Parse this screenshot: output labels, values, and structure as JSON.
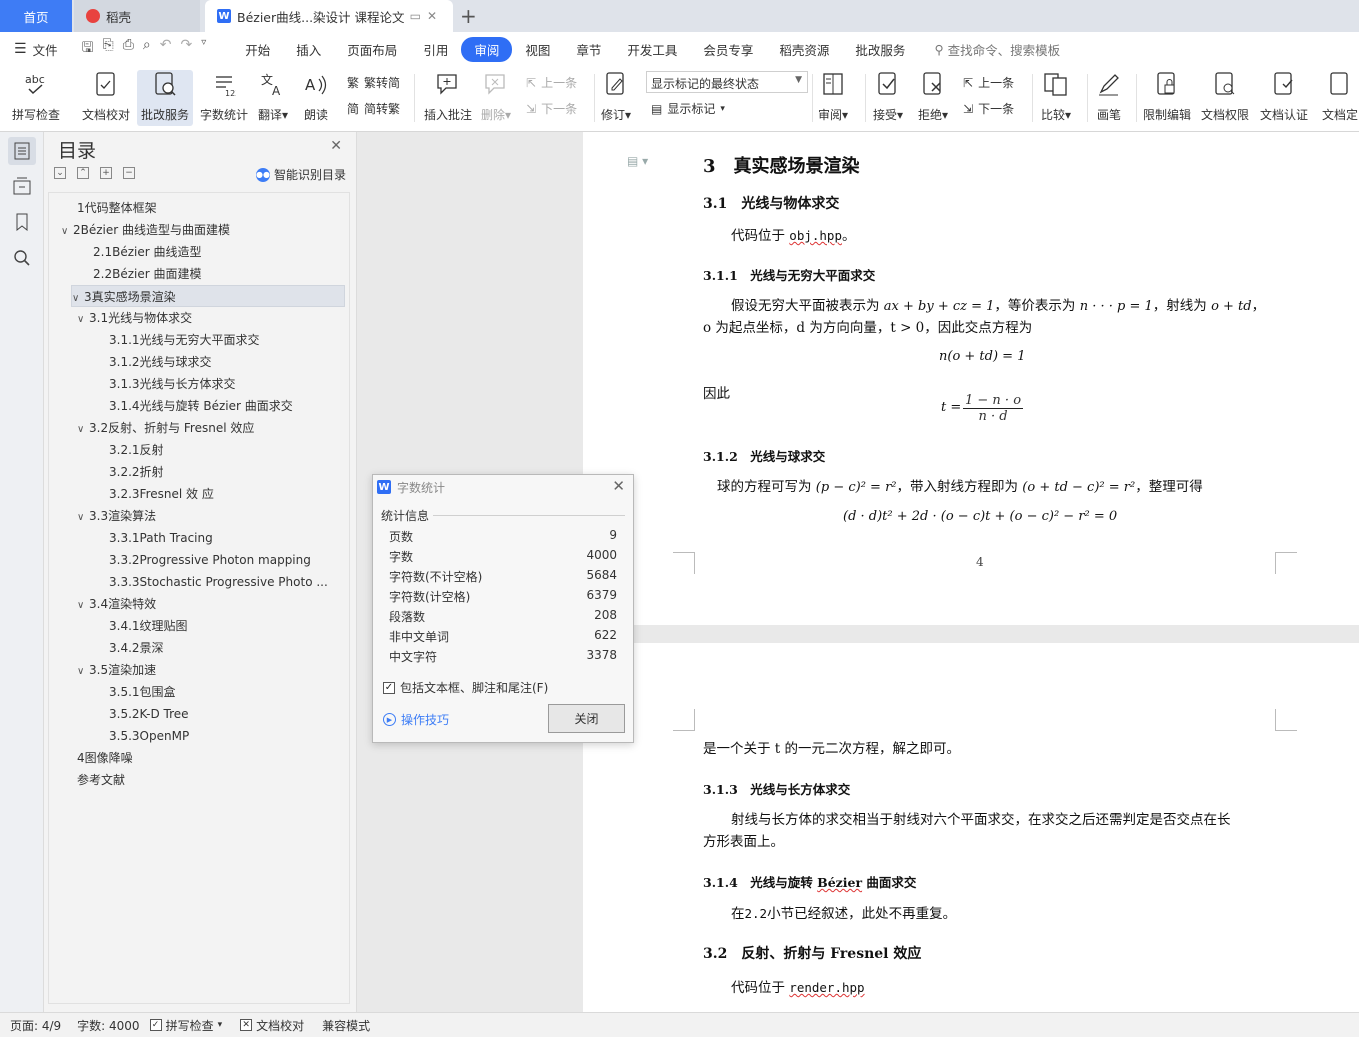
{
  "tabs": {
    "home": "首页",
    "daoke": "稻壳",
    "doc": "Bézier曲线...染设计 课程论文",
    "add": "+"
  },
  "menubar": {
    "file": "文件",
    "items": [
      "开始",
      "插入",
      "页面布局",
      "引用",
      "审阅",
      "视图",
      "章节",
      "开发工具",
      "会员专享",
      "稻壳资源",
      "批改服务"
    ],
    "active_item": "审阅",
    "search": "查找命令、搜索模板"
  },
  "ribbon": {
    "spellcheck": "拼写检查",
    "doc_check": "文档校对",
    "revise_service": "批改服务",
    "word_count": "字数统计",
    "translate": "翻译",
    "read": "朗读",
    "trad_to_simp": "繁转简",
    "simp_to_trad": "简转繁",
    "insert_comment": "插入批注",
    "delete": "删除",
    "prev_comment": "上一条",
    "next_comment": "下一条",
    "revise": "修订",
    "markup_state": "显示标记的最终状态",
    "show_markup": "显示标记",
    "review": "审阅",
    "accept": "接受",
    "reject": "拒绝",
    "prev_change": "上一条",
    "next_change": "下一条",
    "compare": "比较",
    "pen": "画笔",
    "restrict_edit": "限制编辑",
    "doc_rights": "文档权限",
    "doc_cert": "文档认证",
    "doc_fix": "文档定"
  },
  "toc": {
    "title": "目录",
    "smart": "智能识别目录",
    "items": [
      {
        "text": "1代码整体框架",
        "level": 1,
        "caret": ""
      },
      {
        "text": "2Bézier 曲线造型与曲面建模",
        "level": 1,
        "caret": "∨"
      },
      {
        "text": "2.1Bézier 曲线造型",
        "level": 2,
        "caret": ""
      },
      {
        "text": "2.2Bézier 曲面建模",
        "level": 2,
        "caret": ""
      },
      {
        "text": "3真实感场景渲染",
        "level": 1,
        "caret": "∨"
      },
      {
        "text": "3.1光线与物体求交",
        "level": 2,
        "caret": "∨"
      },
      {
        "text": "3.1.1光线与无穷大平面求交",
        "level": 3,
        "caret": ""
      },
      {
        "text": "3.1.2光线与球求交",
        "level": 3,
        "caret": ""
      },
      {
        "text": "3.1.3光线与长方体求交",
        "level": 3,
        "caret": ""
      },
      {
        "text": "3.1.4光线与旋转 Bézier 曲面求交",
        "level": 3,
        "caret": ""
      },
      {
        "text": "3.2反射、折射与 Fresnel 效应",
        "level": 2,
        "caret": "∨"
      },
      {
        "text": "3.2.1反射",
        "level": 3,
        "caret": ""
      },
      {
        "text": "3.2.2折射",
        "level": 3,
        "caret": ""
      },
      {
        "text": "3.2.3Fresnel 效 应",
        "level": 3,
        "caret": ""
      },
      {
        "text": "3.3渲染算法",
        "level": 2,
        "caret": "∨"
      },
      {
        "text": "3.3.1Path Tracing",
        "level": 3,
        "caret": ""
      },
      {
        "text": "3.3.2Progressive Photon mapping",
        "level": 3,
        "caret": ""
      },
      {
        "text": "3.3.3Stochastic Progressive Photo ...",
        "level": 3,
        "caret": ""
      },
      {
        "text": "3.4渲染特效",
        "level": 2,
        "caret": "∨"
      },
      {
        "text": "3.4.1纹理贴图",
        "level": 3,
        "caret": ""
      },
      {
        "text": "3.4.2景深",
        "level": 3,
        "caret": ""
      },
      {
        "text": "3.5渲染加速",
        "level": 2,
        "caret": "∨"
      },
      {
        "text": "3.5.1包围盒",
        "level": 3,
        "caret": ""
      },
      {
        "text": "3.5.2K-D Tree",
        "level": 3,
        "caret": ""
      },
      {
        "text": "3.5.3OpenMP",
        "level": 3,
        "caret": ""
      },
      {
        "text": "4图像降噪",
        "level": 1,
        "caret": ""
      },
      {
        "text": "参考文献",
        "level": 1,
        "caret": ""
      }
    ],
    "selected_index": 4
  },
  "document": {
    "h3": "3　真实感场景渲染",
    "h31": "3.1　光线与物体求交",
    "p_obj_prefix": "代码位于 ",
    "p_obj_code": "obj.hpp",
    "p_obj_suffix": "。",
    "h311": "3.1.1　光线与无穷大平面求交",
    "p_plane_1a": "假设无穷大平面被表示为 ",
    "p_plane_1b": "ax + by + cz = 1",
    "p_plane_1c": "，等价表示为 ",
    "p_plane_1d": "n · · · p = 1",
    "p_plane_1e": "，射线为 ",
    "p_plane_1f": "o + td",
    "p_plane_1g": "，",
    "p_plane_2": "o 为起点坐标，d 为方向向量，t > 0，因此交点方程为",
    "eq_plane": "n(o + td) = 1",
    "therefore": "因此",
    "eq_t_lhs": "t =",
    "eq_t_num": "1 − n · o",
    "eq_t_den": "n · d",
    "h312": "3.1.2　光线与球求交",
    "p_sphere_a": "球的方程可写为 ",
    "p_sphere_b": "(p − c)² = r²",
    "p_sphere_c": "，带入射线方程即为 ",
    "p_sphere_d": "(o + td − c)² = r²",
    "p_sphere_e": "，整理可得",
    "eq_sphere": "(d · d)t² + 2d · (o − c)t + (o − c)² − r² = 0",
    "page_number": "4",
    "p_quad": "是一个关于 t 的一元二次方程，解之即可。",
    "h313": "3.1.3　光线与长方体求交",
    "p_box_1": "射线与长方体的求交相当于射线对六个平面求交，在求交之后还需判定是否交点在长",
    "p_box_2": "方形表面上。",
    "h314a": "3.1.4　光线与旋转 ",
    "h314b": "Bézier",
    "h314c": " 曲面求交",
    "p_bezier_a": "在",
    "p_bezier_b": "2.2",
    "p_bezier_c": "小节已经叙述，此处不再重复。",
    "h32": "3.2　反射、折射与 Fresnel 效应",
    "p_render_prefix": "代码位于 ",
    "p_render_code": "render.hpp"
  },
  "dialog": {
    "title": "字数统计",
    "section": "统计信息",
    "stats": [
      {
        "label": "页数",
        "value": "9"
      },
      {
        "label": "字数",
        "value": "4000"
      },
      {
        "label": "字符数(不计空格)",
        "value": "5684"
      },
      {
        "label": "字符数(计空格)",
        "value": "6379"
      },
      {
        "label": "段落数",
        "value": "208"
      },
      {
        "label": "非中文单词",
        "value": "622"
      },
      {
        "label": "中文字符",
        "value": "3378"
      }
    ],
    "include_label": "包括文本框、脚注和尾注(F)",
    "include_checked": true,
    "tips": "操作技巧",
    "close": "关闭"
  },
  "statusbar": {
    "page": "页面: 4/9",
    "words": "字数: 4000",
    "spellcheck": "拼写检查",
    "doccheck": "文档校对",
    "compat": "兼容模式"
  },
  "colors": {
    "accent": "#2f6ef5",
    "tab_home": "#3e7cf5",
    "link": "#3d7df6"
  }
}
